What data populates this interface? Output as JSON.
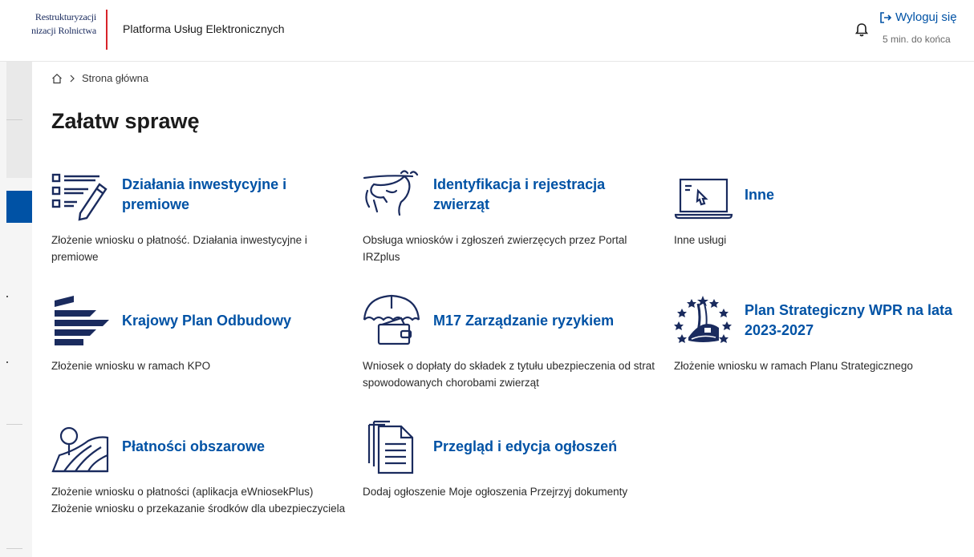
{
  "header": {
    "logo_line1": "Restrukturyzacji",
    "logo_line2": "nizacji Rolnictwa",
    "platform_title": "Platforma Usług Elektronicznych",
    "logout_label": "Wyloguj się",
    "session_text": "5 min. do końca"
  },
  "breadcrumb": {
    "current": "Strona główna"
  },
  "main": {
    "title": "Załatw sprawę",
    "tiles": [
      {
        "title": "Działania inwestycyjne i premiowe",
        "description": "Złożenie wniosku o płatność. Działania inwestycyjne i premiowe",
        "icon": "checklist-pencil-icon"
      },
      {
        "title": "Identyfikacja i rejestracja zwierząt",
        "description": "Obsługa wniosków i zgłoszeń zwierzęcych przez Portal IRZplus",
        "icon": "cow-icon"
      },
      {
        "title": "Inne",
        "description": "Inne usługi",
        "icon": "laptop-icon"
      },
      {
        "title": "Krajowy Plan Odbudowy",
        "description": "Złożenie wniosku w ramach KPO",
        "icon": "kpo-logo-icon"
      },
      {
        "title": "M17 Zarządzanie ryzykiem",
        "description": "Wniosek o dopłaty do składek z tytułu ubezpieczenia od strat spowodowanych chorobami zwierząt",
        "icon": "umbrella-wallet-icon"
      },
      {
        "title": "Plan Strategiczny WPR na lata 2023-2027",
        "description": "Złożenie wniosku w ramach Planu Strategicznego",
        "icon": "eu-stars-icon"
      },
      {
        "title": "Płatności obszarowe",
        "description_lines": [
          "Złożenie wniosku o płatności (aplikacja eWniosekPlus)",
          "Złożenie wniosku o przekazanie środków dla ubezpieczyciela"
        ],
        "icon": "field-tree-icon"
      },
      {
        "title": "Przegląd i edycja ogłoszeń",
        "description": "Dodaj ogłoszenie Moje ogłoszenia Przejrzyj dokumenty",
        "icon": "documents-icon"
      }
    ]
  },
  "colors": {
    "accent": "#0052a5",
    "logo_divider": "#d8232a",
    "brand_navy": "#1a2b5e"
  }
}
